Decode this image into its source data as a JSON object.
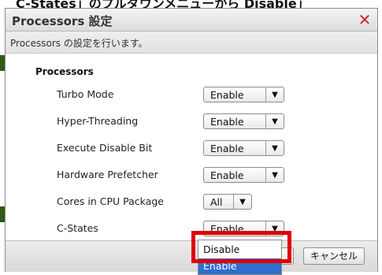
{
  "caption_text": "C-States」のプルダウンメニューから Disable」",
  "dialog": {
    "title": "Processors 設定",
    "subtitle": "Processors の設定を行います。",
    "section_title": "Processors"
  },
  "settings": [
    {
      "label": "Turbo Mode",
      "value": "Enable"
    },
    {
      "label": "Hyper-Threading",
      "value": "Enable"
    },
    {
      "label": "Execute Disable Bit",
      "value": "Enable"
    },
    {
      "label": "Hardware Prefetcher",
      "value": "Enable"
    },
    {
      "label": "Cores in CPU Package",
      "value": "All"
    },
    {
      "label": "C-States",
      "value": "Enable"
    }
  ],
  "dropdown_options": [
    "Disable",
    "Enable"
  ],
  "dropdown_selected": "Enable",
  "buttons": {
    "cancel": "キャンセル"
  },
  "icons": {
    "close": "close-icon",
    "select_arrow": "triangle-down-icon"
  },
  "colors": {
    "close_icon": "#d12626",
    "selection_highlight": "#2f6fce",
    "callout_border": "#e00000"
  }
}
